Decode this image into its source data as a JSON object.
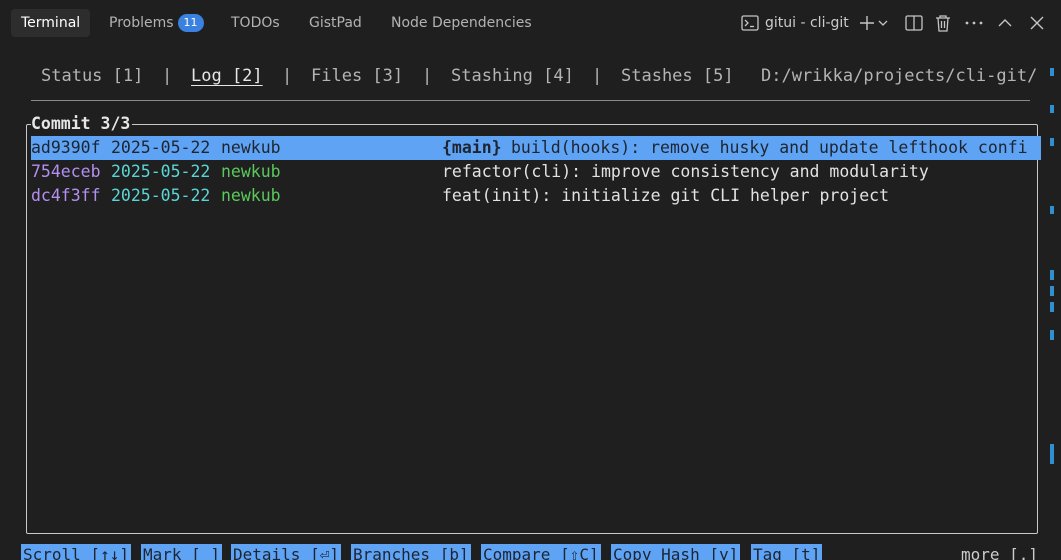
{
  "panel": {
    "tabs": [
      {
        "label": "Terminal",
        "active": true
      },
      {
        "label": "Problems",
        "badge": "11"
      },
      {
        "label": "TODOs"
      },
      {
        "label": "GistPad"
      },
      {
        "label": "Node Dependencies"
      }
    ],
    "terminal_title": "gitui - cli-git",
    "icons": [
      "terminal-icon",
      "plus-icon",
      "chevron-down-icon",
      "split-icon",
      "trash-icon",
      "ellipsis-icon",
      "chevron-up-icon",
      "close-icon"
    ]
  },
  "gitui": {
    "nav": [
      {
        "label": "Status [1]"
      },
      {
        "label": "Log [2]",
        "selected": true
      },
      {
        "label": "Files [3]"
      },
      {
        "label": "Stashing [4]"
      },
      {
        "label": "Stashes [5]"
      }
    ],
    "separator": "|",
    "path": "D:/wrikka/projects/cli-git/",
    "commit_title": "Commit 3/3",
    "commits": [
      {
        "hash": "ad9390f",
        "date": "2025-05-22",
        "author": "newkub",
        "branch": "{main}",
        "message": "build(hooks): remove husky and update lefthook confi"
      },
      {
        "hash": "754eceb",
        "date": "2025-05-22",
        "author": "newkub",
        "branch": "",
        "message": "refactor(cli): improve consistency and modularity"
      },
      {
        "hash": "dc4f3ff",
        "date": "2025-05-22",
        "author": "newkub",
        "branch": "",
        "message": "feat(init): initialize git CLI helper project"
      }
    ],
    "keys": [
      "Scroll [↑↓]",
      "Mark [ ]",
      "Details [⏎]",
      "Branches [b]",
      "Compare [⇧C]",
      "Copy Hash [y]",
      "Tag [t]"
    ],
    "more": "more [.]"
  },
  "colors": {
    "selection": "#5fa3f5",
    "hash": "#b48ef0",
    "date": "#5ad6d6",
    "author": "#5bc85b"
  }
}
